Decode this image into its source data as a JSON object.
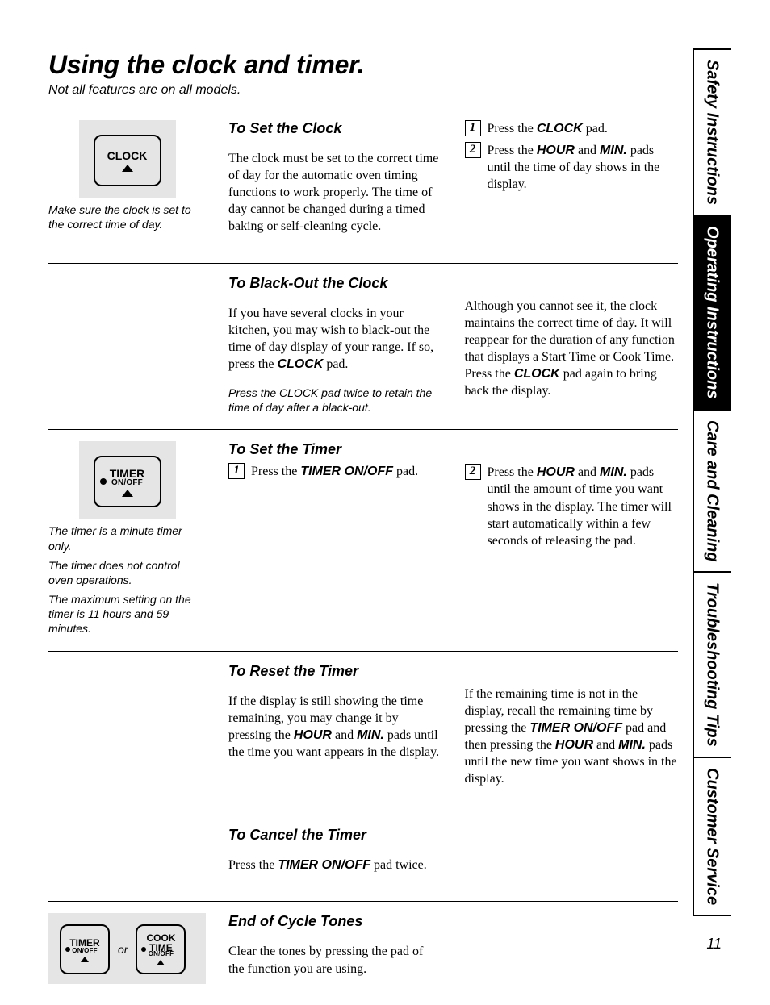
{
  "title": "Using the clock and timer.",
  "subtitle": "Not all features are on all models.",
  "page_number": "11",
  "side_tabs": [
    {
      "label": "Safety Instructions",
      "active": false
    },
    {
      "label": "Operating Instructions",
      "active": true
    },
    {
      "label": "Care and Cleaning",
      "active": false
    },
    {
      "label": "Troubleshooting Tips",
      "active": false
    },
    {
      "label": "Customer Service",
      "active": false
    }
  ],
  "pad_labels": {
    "clock": "CLOCK",
    "timer": "TIMER",
    "timer_sub": "ON/OFF",
    "cook_time_1": "COOK",
    "cook_time_2": "TIME",
    "cook_time_sub": "ON/OFF",
    "or": "or"
  },
  "set_clock": {
    "heading": "To Set the Clock",
    "body": "The clock must be set to the correct time of day for the automatic oven timing functions to work properly. The time of day cannot be changed during a timed baking or self-cleaning cycle.",
    "steps": [
      {
        "n": "1",
        "pre": "Press the ",
        "pad": "CLOCK",
        "post": " pad."
      },
      {
        "n": "2",
        "pre": "Press the ",
        "pad1": "HOUR",
        "mid": " and ",
        "pad2": "MIN.",
        "post": " pads until the time of day shows in the display."
      }
    ],
    "caption": "Make sure the clock is set to the correct time of day."
  },
  "blackout": {
    "heading": "To Black-Out the Clock",
    "left_pre": "If you have several clocks in your kitchen, you may wish to black-out the time of day display of your range. If so, press the ",
    "left_pad": "CLOCK",
    "left_post": " pad.",
    "left_hint": "Press the CLOCK pad twice to retain the time of day after a black-out.",
    "right_pre": "Although you cannot see it, the clock maintains the correct time of day. It will reappear for the duration of any function that displays a Start Time or Cook Time. Press the ",
    "right_pad": "CLOCK",
    "right_post": " pad again to bring back the display."
  },
  "set_timer": {
    "heading": "To Set the Timer",
    "caption1": "The timer is a minute timer only.",
    "caption2": "The timer does not control oven operations.",
    "caption3": "The maximum setting on the timer is 11 hours and 59 minutes.",
    "step1": {
      "n": "1",
      "pre": "Press the ",
      "pad": "TIMER ON/OFF",
      "post": " pad."
    },
    "step2": {
      "n": "2",
      "pre": "Press the ",
      "pad1": "HOUR",
      "mid": " and ",
      "pad2": "MIN.",
      "post": " pads until the amount of time you want shows in the display. The timer will start automatically within a few seconds of releasing the pad."
    }
  },
  "reset_timer": {
    "heading": "To Reset the Timer",
    "left_pre": "If the display is still showing the time remaining, you may change it by pressing the ",
    "left_pad1": "HOUR",
    "left_mid": " and ",
    "left_pad2": "MIN.",
    "left_post": " pads until the time you want appears in the display.",
    "right_pre": "If the remaining time is not in the display, recall the remaining time by pressing the ",
    "right_pad1": "TIMER ON/OFF",
    "right_mid1": " pad and then pressing the ",
    "right_pad2": "HOUR",
    "right_mid2": " and ",
    "right_pad3": "MIN.",
    "right_post": " pads until the new time you want shows in the display."
  },
  "cancel_timer": {
    "heading": "To Cancel the Timer",
    "pre": "Press the ",
    "pad": "TIMER ON/OFF",
    "post": " pad twice."
  },
  "end_tones": {
    "heading": "End of Cycle Tones",
    "body": "Clear the tones by pressing the pad of the function you are using."
  }
}
